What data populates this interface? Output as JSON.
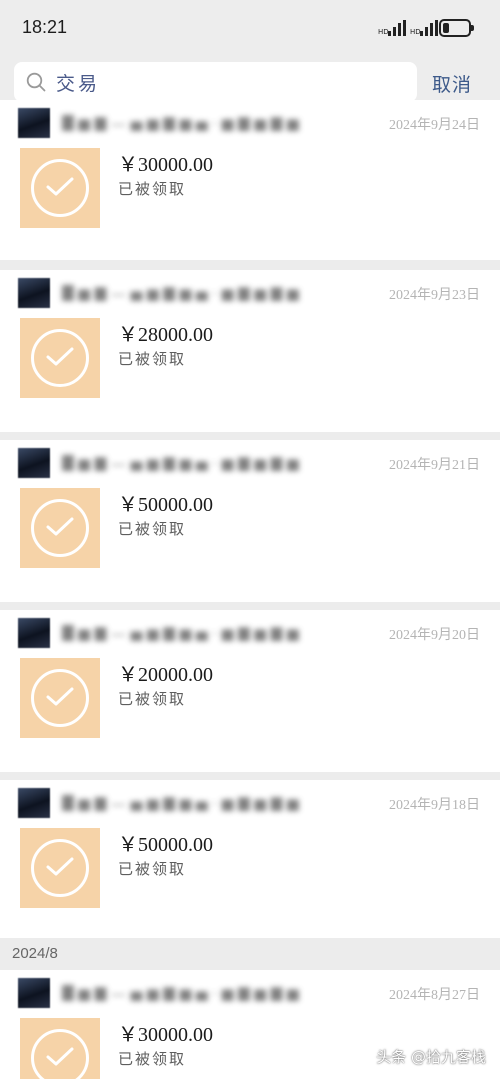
{
  "status_bar": {
    "time": "18:21"
  },
  "search": {
    "query": "交易",
    "cancel_label": "取消"
  },
  "colors": {
    "accent": "#3d5a8a",
    "money_icon_bg": "#f6d3a8",
    "page_bg": "#ececec"
  },
  "transactions": [
    {
      "date": "2024年9月24日",
      "amount": "￥30000.00",
      "status": "已被领取"
    },
    {
      "date": "2024年9月23日",
      "amount": "￥28000.00",
      "status": "已被领取"
    },
    {
      "date": "2024年9月21日",
      "amount": "￥50000.00",
      "status": "已被领取"
    },
    {
      "date": "2024年9月20日",
      "amount": "￥20000.00",
      "status": "已被领取"
    },
    {
      "date": "2024年9月18日",
      "amount": "￥50000.00",
      "status": "已被领取"
    },
    {
      "date": "2024年8月27日",
      "amount": "￥30000.00",
      "status": "已被领取"
    }
  ],
  "section_header": "2024/8",
  "watermark": "头条 @拾九客栈"
}
